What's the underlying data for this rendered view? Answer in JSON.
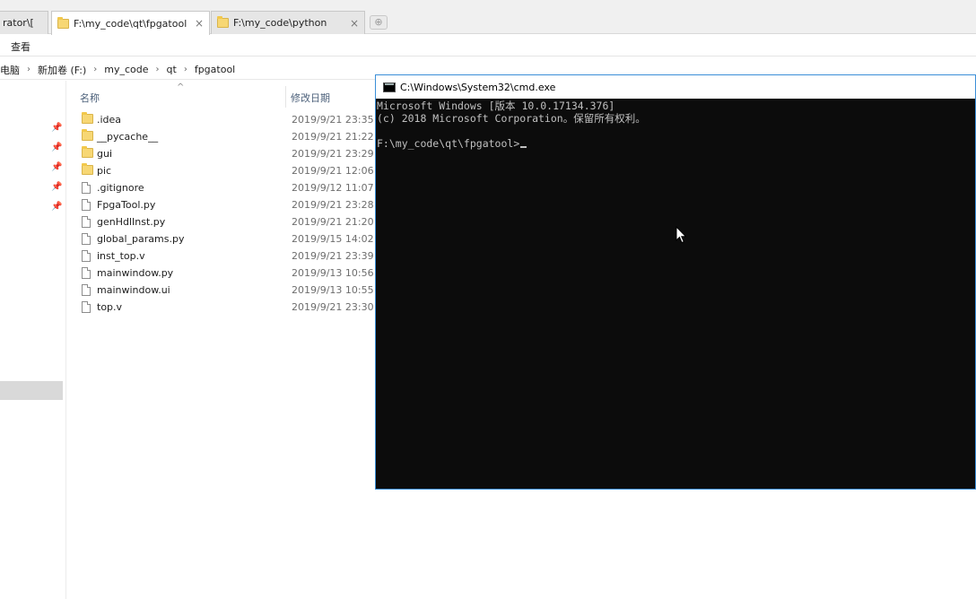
{
  "tabs": [
    {
      "label": "rator\\[",
      "close": "×"
    },
    {
      "label": "F:\\my_code\\qt\\fpgatool",
      "close": "×"
    },
    {
      "label": "F:\\my_code\\python",
      "close": "×"
    }
  ],
  "ribbon": {
    "view_label": "查看"
  },
  "address": {
    "segments": [
      "电脑",
      "新加卷 (F:)",
      "my_code",
      "qt",
      "fpgatool"
    ],
    "separator": "›"
  },
  "columns": {
    "name": "名称",
    "date": "修改日期"
  },
  "files": [
    {
      "name": ".idea",
      "date": "2019/9/21 23:35",
      "type": "folder"
    },
    {
      "name": "__pycache__",
      "date": "2019/9/21 21:22",
      "type": "folder"
    },
    {
      "name": "gui",
      "date": "2019/9/21 23:29",
      "type": "folder"
    },
    {
      "name": "pic",
      "date": "2019/9/21 12:06",
      "type": "folder"
    },
    {
      "name": ".gitignore",
      "date": "2019/9/12 11:07",
      "type": "file"
    },
    {
      "name": "FpgaTool.py",
      "date": "2019/9/21 23:28",
      "type": "file"
    },
    {
      "name": "genHdlInst.py",
      "date": "2019/9/21 21:20",
      "type": "file"
    },
    {
      "name": "global_params.py",
      "date": "2019/9/15 14:02",
      "type": "file"
    },
    {
      "name": "inst_top.v",
      "date": "2019/9/21 23:39",
      "type": "file"
    },
    {
      "name": "mainwindow.py",
      "date": "2019/9/13 10:56",
      "type": "file"
    },
    {
      "name": "mainwindow.ui",
      "date": "2019/9/13 10:55",
      "type": "file"
    },
    {
      "name": "top.v",
      "date": "2019/9/21 23:30",
      "type": "file"
    }
  ],
  "cmd": {
    "title": "C:\\Windows\\System32\\cmd.exe",
    "lines": [
      "Microsoft Windows [版本 10.0.17134.376]",
      "(c) 2018 Microsoft Corporation。保留所有权利。",
      ""
    ],
    "prompt": "F:\\my_code\\qt\\fpgatool>"
  }
}
